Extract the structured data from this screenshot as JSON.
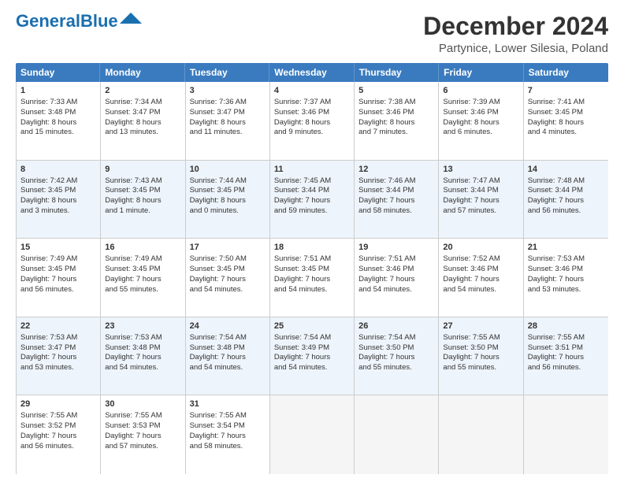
{
  "logo": {
    "text1": "General",
    "text2": "Blue"
  },
  "title": "December 2024",
  "subtitle": "Partynice, Lower Silesia, Poland",
  "header_days": [
    "Sunday",
    "Monday",
    "Tuesday",
    "Wednesday",
    "Thursday",
    "Friday",
    "Saturday"
  ],
  "weeks": [
    [
      {
        "day": "1",
        "lines": [
          "Sunrise: 7:33 AM",
          "Sunset: 3:48 PM",
          "Daylight: 8 hours",
          "and 15 minutes."
        ],
        "empty": false,
        "alt": false
      },
      {
        "day": "2",
        "lines": [
          "Sunrise: 7:34 AM",
          "Sunset: 3:47 PM",
          "Daylight: 8 hours",
          "and 13 minutes."
        ],
        "empty": false,
        "alt": false
      },
      {
        "day": "3",
        "lines": [
          "Sunrise: 7:36 AM",
          "Sunset: 3:47 PM",
          "Daylight: 8 hours",
          "and 11 minutes."
        ],
        "empty": false,
        "alt": false
      },
      {
        "day": "4",
        "lines": [
          "Sunrise: 7:37 AM",
          "Sunset: 3:46 PM",
          "Daylight: 8 hours",
          "and 9 minutes."
        ],
        "empty": false,
        "alt": false
      },
      {
        "day": "5",
        "lines": [
          "Sunrise: 7:38 AM",
          "Sunset: 3:46 PM",
          "Daylight: 8 hours",
          "and 7 minutes."
        ],
        "empty": false,
        "alt": false
      },
      {
        "day": "6",
        "lines": [
          "Sunrise: 7:39 AM",
          "Sunset: 3:46 PM",
          "Daylight: 8 hours",
          "and 6 minutes."
        ],
        "empty": false,
        "alt": false
      },
      {
        "day": "7",
        "lines": [
          "Sunrise: 7:41 AM",
          "Sunset: 3:45 PM",
          "Daylight: 8 hours",
          "and 4 minutes."
        ],
        "empty": false,
        "alt": false
      }
    ],
    [
      {
        "day": "8",
        "lines": [
          "Sunrise: 7:42 AM",
          "Sunset: 3:45 PM",
          "Daylight: 8 hours",
          "and 3 minutes."
        ],
        "empty": false,
        "alt": true
      },
      {
        "day": "9",
        "lines": [
          "Sunrise: 7:43 AM",
          "Sunset: 3:45 PM",
          "Daylight: 8 hours",
          "and 1 minute."
        ],
        "empty": false,
        "alt": true
      },
      {
        "day": "10",
        "lines": [
          "Sunrise: 7:44 AM",
          "Sunset: 3:45 PM",
          "Daylight: 8 hours",
          "and 0 minutes."
        ],
        "empty": false,
        "alt": true
      },
      {
        "day": "11",
        "lines": [
          "Sunrise: 7:45 AM",
          "Sunset: 3:44 PM",
          "Daylight: 7 hours",
          "and 59 minutes."
        ],
        "empty": false,
        "alt": true
      },
      {
        "day": "12",
        "lines": [
          "Sunrise: 7:46 AM",
          "Sunset: 3:44 PM",
          "Daylight: 7 hours",
          "and 58 minutes."
        ],
        "empty": false,
        "alt": true
      },
      {
        "day": "13",
        "lines": [
          "Sunrise: 7:47 AM",
          "Sunset: 3:44 PM",
          "Daylight: 7 hours",
          "and 57 minutes."
        ],
        "empty": false,
        "alt": true
      },
      {
        "day": "14",
        "lines": [
          "Sunrise: 7:48 AM",
          "Sunset: 3:44 PM",
          "Daylight: 7 hours",
          "and 56 minutes."
        ],
        "empty": false,
        "alt": true
      }
    ],
    [
      {
        "day": "15",
        "lines": [
          "Sunrise: 7:49 AM",
          "Sunset: 3:45 PM",
          "Daylight: 7 hours",
          "and 56 minutes."
        ],
        "empty": false,
        "alt": false
      },
      {
        "day": "16",
        "lines": [
          "Sunrise: 7:49 AM",
          "Sunset: 3:45 PM",
          "Daylight: 7 hours",
          "and 55 minutes."
        ],
        "empty": false,
        "alt": false
      },
      {
        "day": "17",
        "lines": [
          "Sunrise: 7:50 AM",
          "Sunset: 3:45 PM",
          "Daylight: 7 hours",
          "and 54 minutes."
        ],
        "empty": false,
        "alt": false
      },
      {
        "day": "18",
        "lines": [
          "Sunrise: 7:51 AM",
          "Sunset: 3:45 PM",
          "Daylight: 7 hours",
          "and 54 minutes."
        ],
        "empty": false,
        "alt": false
      },
      {
        "day": "19",
        "lines": [
          "Sunrise: 7:51 AM",
          "Sunset: 3:46 PM",
          "Daylight: 7 hours",
          "and 54 minutes."
        ],
        "empty": false,
        "alt": false
      },
      {
        "day": "20",
        "lines": [
          "Sunrise: 7:52 AM",
          "Sunset: 3:46 PM",
          "Daylight: 7 hours",
          "and 54 minutes."
        ],
        "empty": false,
        "alt": false
      },
      {
        "day": "21",
        "lines": [
          "Sunrise: 7:53 AM",
          "Sunset: 3:46 PM",
          "Daylight: 7 hours",
          "and 53 minutes."
        ],
        "empty": false,
        "alt": false
      }
    ],
    [
      {
        "day": "22",
        "lines": [
          "Sunrise: 7:53 AM",
          "Sunset: 3:47 PM",
          "Daylight: 7 hours",
          "and 53 minutes."
        ],
        "empty": false,
        "alt": true
      },
      {
        "day": "23",
        "lines": [
          "Sunrise: 7:53 AM",
          "Sunset: 3:48 PM",
          "Daylight: 7 hours",
          "and 54 minutes."
        ],
        "empty": false,
        "alt": true
      },
      {
        "day": "24",
        "lines": [
          "Sunrise: 7:54 AM",
          "Sunset: 3:48 PM",
          "Daylight: 7 hours",
          "and 54 minutes."
        ],
        "empty": false,
        "alt": true
      },
      {
        "day": "25",
        "lines": [
          "Sunrise: 7:54 AM",
          "Sunset: 3:49 PM",
          "Daylight: 7 hours",
          "and 54 minutes."
        ],
        "empty": false,
        "alt": true
      },
      {
        "day": "26",
        "lines": [
          "Sunrise: 7:54 AM",
          "Sunset: 3:50 PM",
          "Daylight: 7 hours",
          "and 55 minutes."
        ],
        "empty": false,
        "alt": true
      },
      {
        "day": "27",
        "lines": [
          "Sunrise: 7:55 AM",
          "Sunset: 3:50 PM",
          "Daylight: 7 hours",
          "and 55 minutes."
        ],
        "empty": false,
        "alt": true
      },
      {
        "day": "28",
        "lines": [
          "Sunrise: 7:55 AM",
          "Sunset: 3:51 PM",
          "Daylight: 7 hours",
          "and 56 minutes."
        ],
        "empty": false,
        "alt": true
      }
    ],
    [
      {
        "day": "29",
        "lines": [
          "Sunrise: 7:55 AM",
          "Sunset: 3:52 PM",
          "Daylight: 7 hours",
          "and 56 minutes."
        ],
        "empty": false,
        "alt": false
      },
      {
        "day": "30",
        "lines": [
          "Sunrise: 7:55 AM",
          "Sunset: 3:53 PM",
          "Daylight: 7 hours",
          "and 57 minutes."
        ],
        "empty": false,
        "alt": false
      },
      {
        "day": "31",
        "lines": [
          "Sunrise: 7:55 AM",
          "Sunset: 3:54 PM",
          "Daylight: 7 hours",
          "and 58 minutes."
        ],
        "empty": false,
        "alt": false
      },
      {
        "day": "",
        "lines": [],
        "empty": true,
        "alt": false
      },
      {
        "day": "",
        "lines": [],
        "empty": true,
        "alt": false
      },
      {
        "day": "",
        "lines": [],
        "empty": true,
        "alt": false
      },
      {
        "day": "",
        "lines": [],
        "empty": true,
        "alt": false
      }
    ]
  ]
}
